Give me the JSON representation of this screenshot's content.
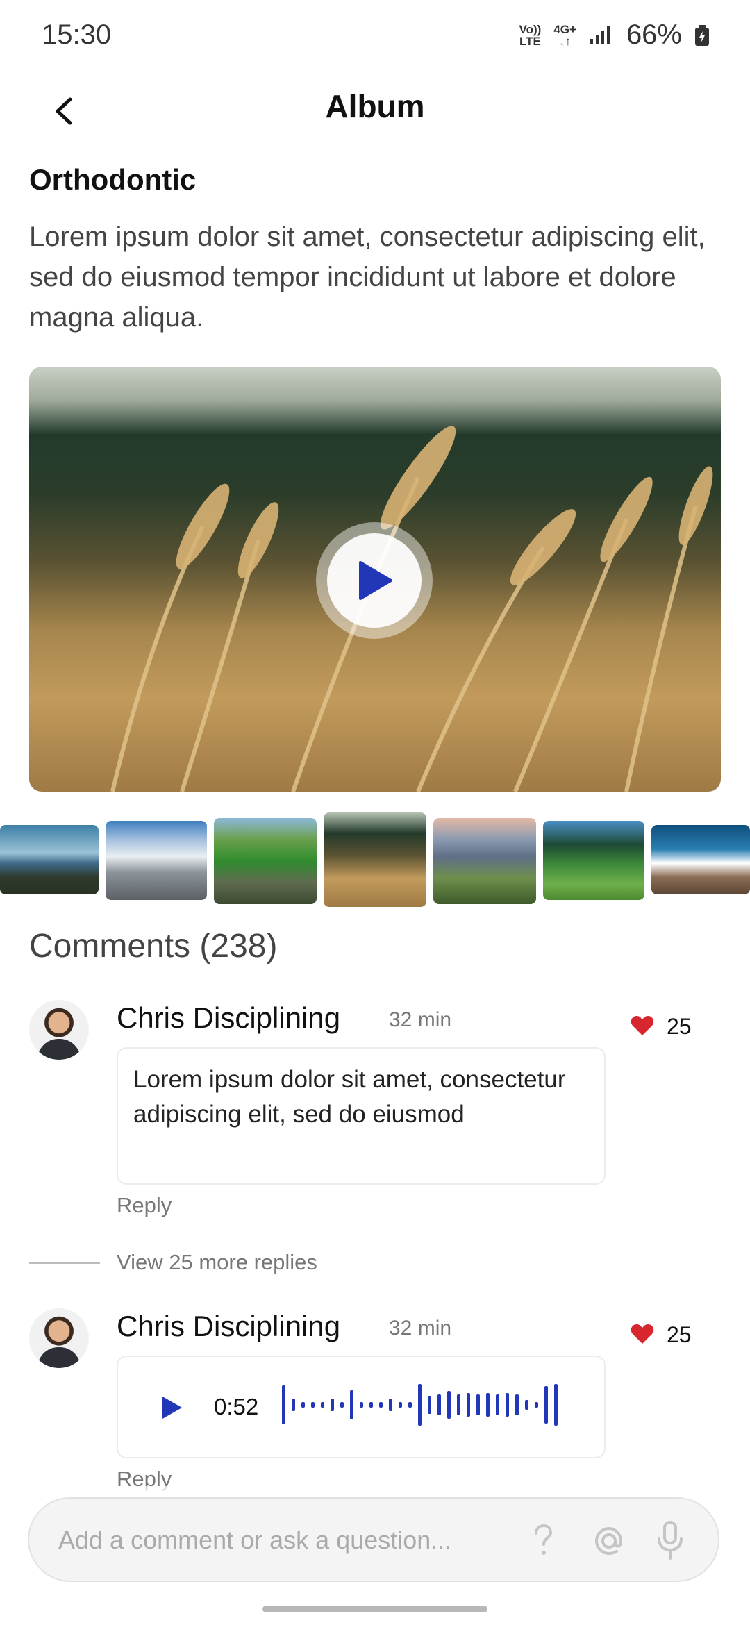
{
  "status_bar": {
    "time": "15:30",
    "volte_top": "Vo))",
    "volte_bottom": "LTE",
    "net_top": "4G+",
    "net_bottom": "↓↑",
    "battery_text": "66%"
  },
  "header": {
    "title": "Album",
    "back_icon": "chevron-left-icon"
  },
  "album": {
    "name": "Orthodontic",
    "description": "Lorem ipsum dolor sit amet, consectetur adipiscing elit, sed do eiusmod tempor incididunt ut labore et dolore magna aliqua."
  },
  "media": {
    "play_icon": "play-icon",
    "accent": "#2236b8"
  },
  "thumbnails": [
    "lake-landscape",
    "snowy-mountain-valley",
    "green-forest-stream",
    "wheat-field",
    "mountain-lake-sunset",
    "green-meadow-trees",
    "snowy-peak-blue-sky"
  ],
  "comments_heading": "Comments (238)",
  "comments": [
    {
      "author": "Chris Disciplining",
      "time": "32 min",
      "likes": "25",
      "text": "Lorem ipsum dolor sit amet, consectetur adipiscing elit, sed do eiusmod",
      "reply_label": "Reply"
    },
    {
      "author": "Chris Disciplining",
      "time": "32 min",
      "likes": "25",
      "audio_duration": "0:52",
      "reply_label": "Reply"
    }
  ],
  "view_more_replies": "View 25 more replies",
  "composer": {
    "placeholder": "Add a comment or ask a question...",
    "question_icon": "question-icon",
    "mention_icon": "at-sign-icon",
    "mic_icon": "microphone-icon"
  },
  "colors": {
    "accent_blue": "#2236b8",
    "heart_red": "#d7262d"
  }
}
